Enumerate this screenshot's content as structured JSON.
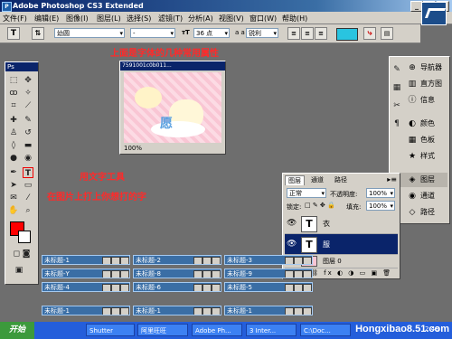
{
  "window": {
    "title": "Adobe Photoshop CS3 Extended",
    "min": "_",
    "max": "□",
    "close": "×"
  },
  "menu": [
    "文件(F)",
    "编辑(E)",
    "图像(I)",
    "图层(L)",
    "选择(S)",
    "滤镜(T)",
    "分析(A)",
    "视图(V)",
    "窗口(W)",
    "帮助(H)"
  ],
  "options": {
    "tool_glyph": "T",
    "font_family": "幼圆",
    "font_style": "-",
    "font_size": "36 点",
    "aa_label": "a a",
    "aa_value": "锐利",
    "text_color": "#29c4e0"
  },
  "doc": {
    "title": "7591001c0b011...",
    "zoom": "100%",
    "watermark": "愿"
  },
  "annotations": {
    "top": "上面是字体的几种常用属性",
    "line1": "用文字工具",
    "line2": "在图片上打上你想打的字"
  },
  "toolbox": {
    "title": "Ps",
    "fg_color": "#ff0000",
    "bg_color": "#ffffff"
  },
  "right_panel": {
    "items": [
      {
        "label": "导航器",
        "icon": "⊕"
      },
      {
        "label": "直方图",
        "icon": "▥"
      },
      {
        "label": "信息",
        "icon": "ⓘ"
      },
      {
        "label": "颜色",
        "icon": "◐"
      },
      {
        "label": "色板",
        "icon": "▦"
      },
      {
        "label": "样式",
        "icon": "★"
      },
      {
        "label": "图层",
        "icon": "◈"
      },
      {
        "label": "通道",
        "icon": "◉"
      },
      {
        "label": "路径",
        "icon": "◇"
      }
    ]
  },
  "layers_panel": {
    "tabs": [
      "图层",
      "通道",
      "路径"
    ],
    "mode": "正常",
    "opacity_label": "不透明度:",
    "opacity": "100%",
    "lock_label": "锁定:",
    "fill_label": "填充:",
    "fill": "100%",
    "layers": [
      {
        "name": "衣",
        "thumb": "T",
        "selected": false
      },
      {
        "name": "服",
        "thumb": "T",
        "selected": true
      },
      {
        "name": "图层 0",
        "thumb": "",
        "selected": false
      }
    ]
  },
  "minimized": [
    "未标题-1",
    "未标题-2",
    "未标题-3",
    "未标题-Y",
    "未标题-8",
    "未标题-9",
    "未标题-4",
    "未标题-6",
    "未标题-5",
    "未标题-1",
    "未标题-1",
    "未标题-1"
  ],
  "taskbar": {
    "start": "开始",
    "tasks": [
      "Shutter",
      "阿里旺旺",
      "Adobe Ph...",
      "3 Inter...",
      "C:\\Doc..."
    ],
    "time": "2:48"
  },
  "watermark": "Hongxibao8.51.com"
}
